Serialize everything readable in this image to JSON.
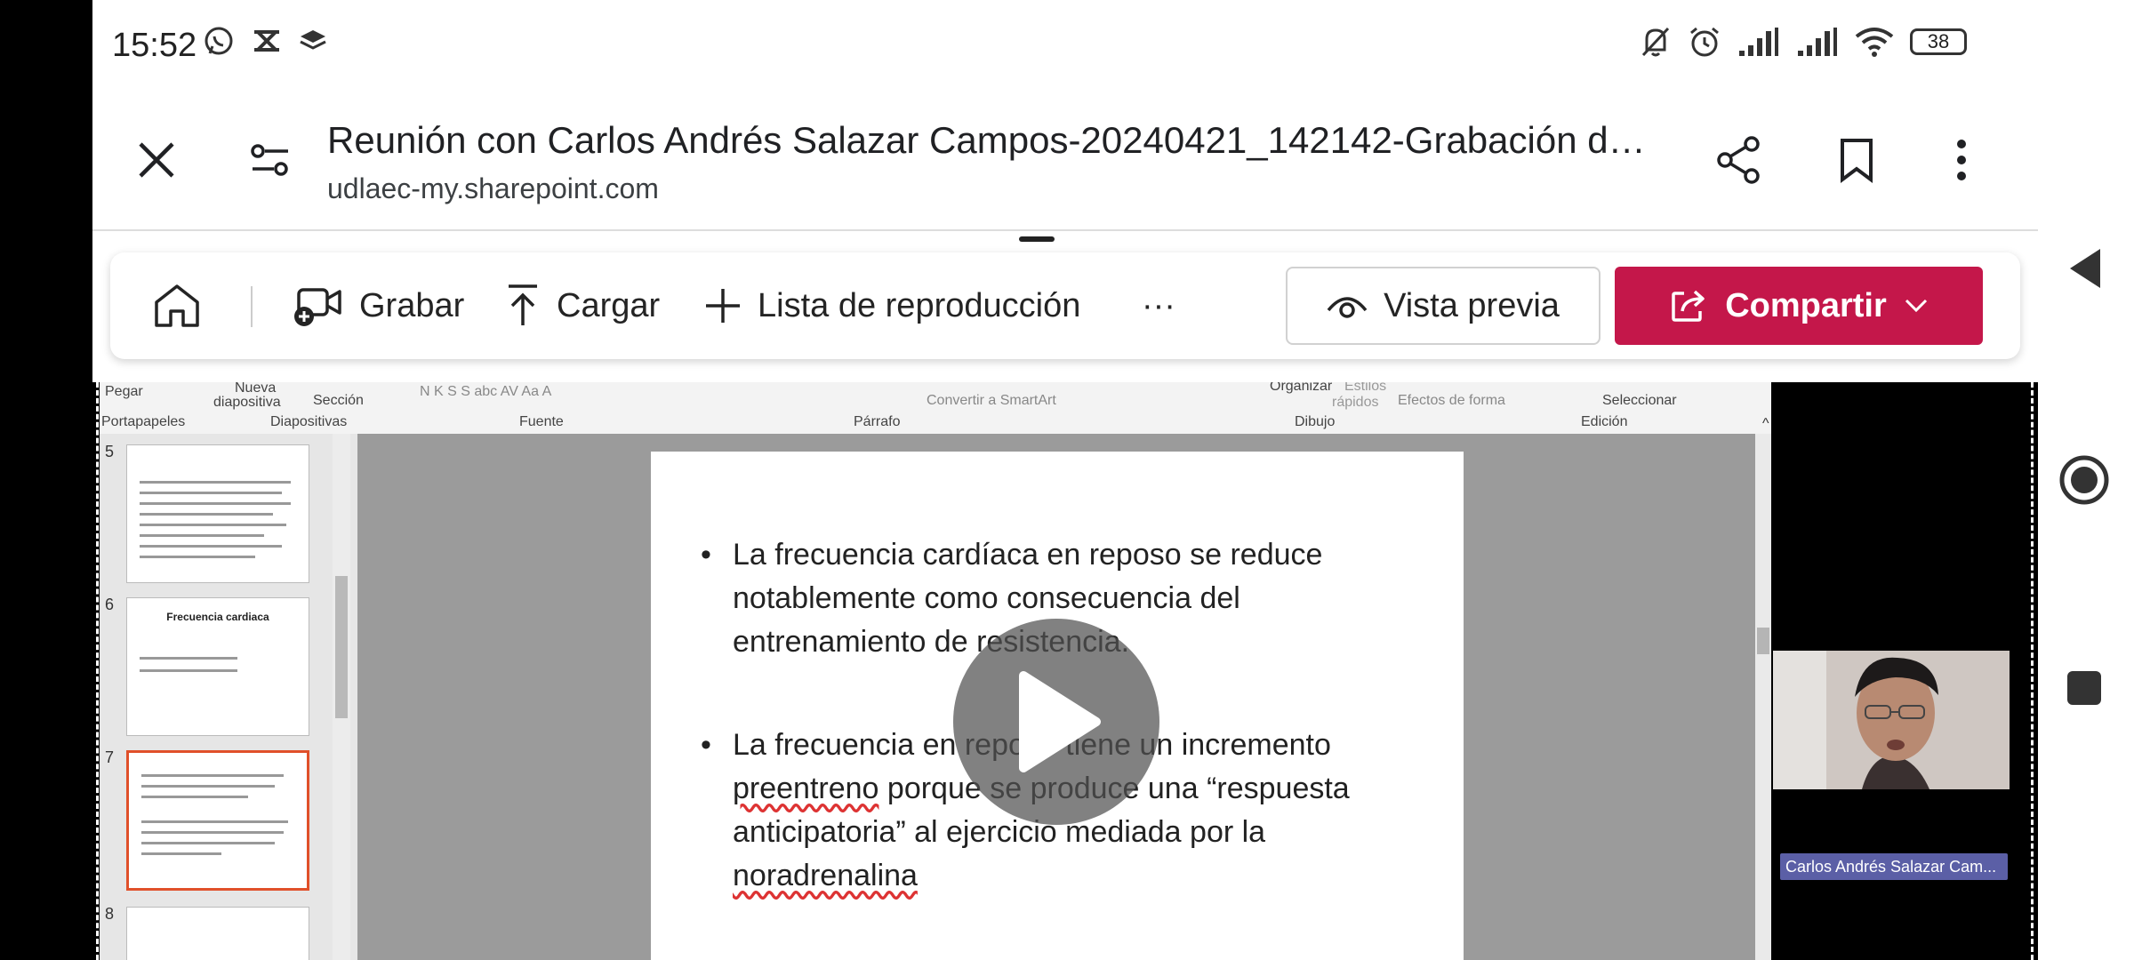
{
  "status_bar": {
    "time": "15:52",
    "battery": "38"
  },
  "header": {
    "title": "Reunión con Carlos Andrés Salazar Campos-20240421_142142-Grabación d…",
    "url": "udlaec-my.sharepoint.com"
  },
  "toolbar": {
    "record_label": "Grabar",
    "upload_label": "Cargar",
    "playlist_label": "Lista de reproducción",
    "more_label": "···",
    "preview_label": "Vista previa",
    "share_label": "Compartir"
  },
  "ppt": {
    "ribbon_top": {
      "pegar": "Pegar",
      "nueva": "Nueva",
      "diapositiva": "diapositiva",
      "seccion": "Sección",
      "fuente_buttons": "N  K  S  S  abc  AV  Aa  A",
      "smartart": "Convertir a SmartArt",
      "organizar": "Organizar",
      "estilos": "Estilos",
      "rapidos": "rápidos",
      "efectos": "Efectos de forma",
      "seleccionar": "Seleccionar"
    },
    "ribbon_groups": {
      "portapapeles": "Portapapeles",
      "diapositivas": "Diapositivas",
      "fuente": "Fuente",
      "parrafo": "Párrafo",
      "dibujo": "Dibujo",
      "edicion": "Edición"
    },
    "thumbnails": [
      {
        "number": "5",
        "title": ""
      },
      {
        "number": "6",
        "title": "Frecuencia cardiaca"
      },
      {
        "number": "7",
        "title": ""
      },
      {
        "number": "8",
        "title": ""
      }
    ],
    "slide": {
      "bullet_symbol": "•",
      "bullet1": "La frecuencia cardíaca en reposo se reduce notablemente como consecuencia del entrenamiento de resistencia.",
      "bullet2_a": "La frecuencia en reposo tiene un incremento ",
      "bullet2_b": "preentreno",
      "bullet2_c": " porque se produce una “respuesta anticipatoria” al ejercicio mediada por la ",
      "bullet2_d": "noradrenalina"
    },
    "participant_name": "Carlos Andrés Salazar Cam..."
  },
  "colors": {
    "accent": "#c4174a",
    "name_tag": "#5b5fa6",
    "selected_thumb": "#e0502a"
  }
}
